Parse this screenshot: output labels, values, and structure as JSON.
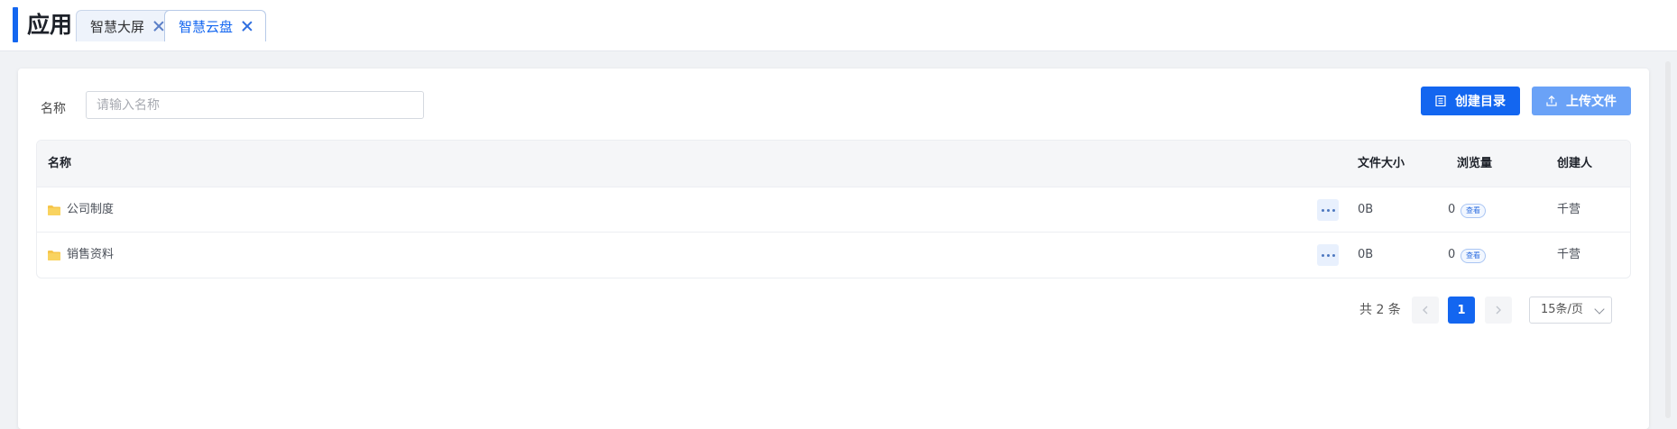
{
  "header": {
    "title": "应用",
    "tabs": [
      {
        "label": "智慧大屏",
        "active": false
      },
      {
        "label": "智慧云盘",
        "active": true
      }
    ]
  },
  "filter": {
    "label": "名称",
    "placeholder": "请输入名称",
    "value": ""
  },
  "toolbar": {
    "create_label": "创建目录",
    "upload_label": "上传文件"
  },
  "table": {
    "columns": [
      "名称",
      "文件大小",
      "浏览量",
      "创建人"
    ],
    "rows": [
      {
        "name": "公司制度",
        "size": "0B",
        "views": "0",
        "view_tag": "查看",
        "creator": "千营"
      },
      {
        "name": "销售资料",
        "size": "0B",
        "views": "0",
        "view_tag": "查看",
        "creator": "千营"
      }
    ]
  },
  "pagination": {
    "total_text": "共 2 条",
    "current_page": "1",
    "page_size": "15条/页"
  },
  "colors": {
    "primary": "#1366f0",
    "primary_light": "#6aa2f7",
    "folder": "#f6c54a"
  }
}
